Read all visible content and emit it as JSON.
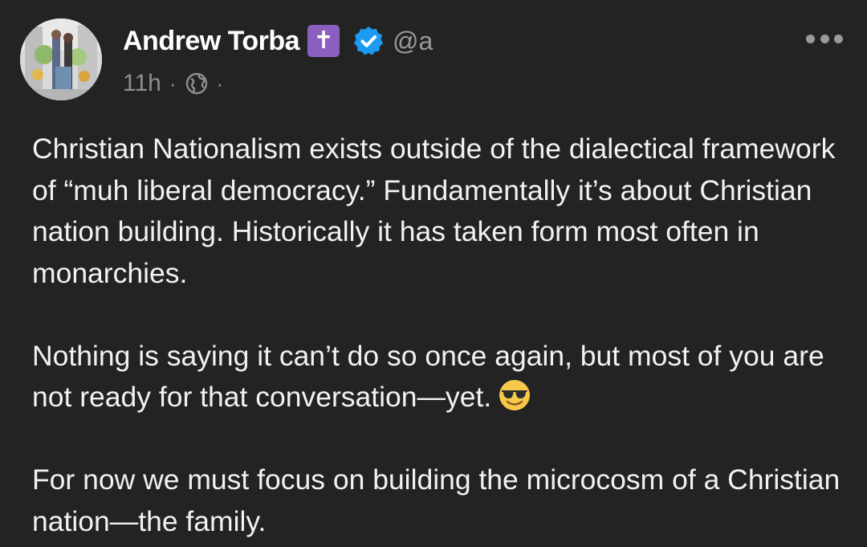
{
  "post": {
    "author": {
      "display_name": "Andrew Torba",
      "cross_badge": "✝",
      "handle": "@a",
      "avatar_icon": "profile-photo",
      "verified_icon": "verified-badge-icon",
      "verified_color": "#1d9bf0",
      "badge_color": "#8b5fbf"
    },
    "meta": {
      "time": "11h",
      "separator": "·",
      "visibility_icon": "globe-icon"
    },
    "more_icon": "more-options-icon",
    "paragraphs": [
      "Christian Nationalism exists outside of the dialectical framework of “muh liberal democracy.” Fundamentally it’s about Christian nation building. Historically it has taken form most often in monarchies.",
      "Nothing is saying it can’t do so once again, but most of you are not ready for that conversation—yet.",
      "For now we must focus on building the microcosm of a Christian nation—the family."
    ],
    "emoji": "smiling-face-with-sunglasses-icon"
  },
  "colors": {
    "background": "#232323",
    "text": "#f2f2f2",
    "muted": "#8e8e8e"
  }
}
